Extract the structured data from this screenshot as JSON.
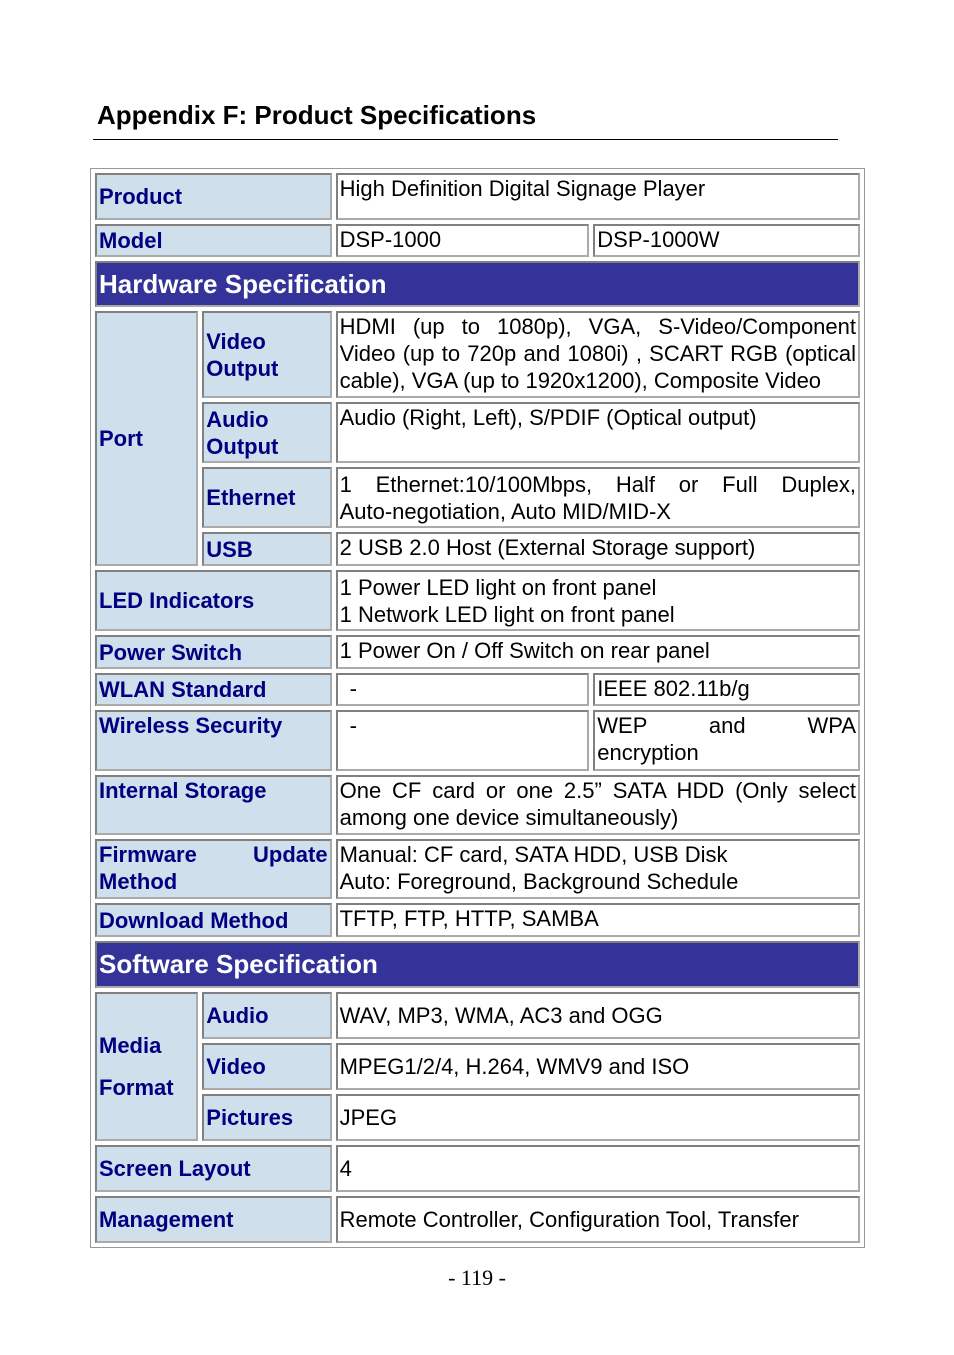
{
  "title": "Appendix F: Product Specifications",
  "rows": {
    "product": {
      "label": "Product",
      "value": "High Definition Digital Signage Player"
    },
    "model": {
      "label": "Model",
      "a": "DSP-1000",
      "b": "DSP-1000W"
    },
    "hardware_header": "Hardware Specification",
    "port": {
      "label": "Port",
      "video": {
        "label": "Video Output",
        "value": [
          "HDMI (up to 1080p), VGA, S-Video/Component",
          "Video (up to 720p and 1080i) , SCART RGB (optical",
          "cable), VGA (up to 1920x1200), Composite Video"
        ]
      },
      "audio": {
        "label": "Audio Output",
        "value": "Audio (Right, Left), S/PDIF (Optical output)"
      },
      "ethernet": {
        "label": "Ethernet",
        "value": [
          "1 Ethernet:10/100Mbps, Half or Full Duplex,",
          "Auto-negotiation, Auto MID/MID-X"
        ]
      },
      "usb": {
        "label": "USB",
        "value": "2 USB 2.0 Host (External Storage support)"
      }
    },
    "led": {
      "label": "LED Indicators",
      "value": [
        "1 Power LED light on front panel",
        "1 Network LED light on front panel"
      ]
    },
    "power": {
      "label": "Power Switch",
      "value": "1 Power On / Off Switch on rear panel"
    },
    "wlan": {
      "label": "WLAN Standard",
      "a": "-",
      "b": "IEEE 802.11b/g"
    },
    "wireless": {
      "label": "Wireless Security",
      "a": "-",
      "b": [
        "WEP and WPA",
        "encryption"
      ]
    },
    "storage": {
      "label": "Internal Storage",
      "value": [
        "One CF card or one 2.5” SATA HDD (Only select",
        "among one device simultaneously)"
      ]
    },
    "firmware": {
      "label": [
        "Firmware Update",
        "Method"
      ],
      "value": [
        "Manual: CF card, SATA HDD, USB Disk",
        "Auto: Foreground, Background Schedule"
      ]
    },
    "download": {
      "label": "Download Method",
      "value": "TFTP, FTP, HTTP, SAMBA"
    },
    "software_header": "Software Specification",
    "media": {
      "label": [
        "Media",
        "Format"
      ],
      "audio": {
        "label": "Audio",
        "value": "WAV, MP3, WMA, AC3 and OGG"
      },
      "video": {
        "label": "Video",
        "value": "MPEG1/2/4, H.264, WMV9 and ISO"
      },
      "pictures": {
        "label": "Pictures",
        "value": "JPEG"
      }
    },
    "screen": {
      "label": "Screen Layout",
      "value": "4"
    },
    "management": {
      "label": "Management",
      "value": "Remote Controller, Configuration Tool, Transfer"
    }
  },
  "page_number": "- 119 -",
  "colors": {
    "label_bg": "#cfdfec",
    "label_text": "#000080",
    "header_bg": "#333399"
  }
}
